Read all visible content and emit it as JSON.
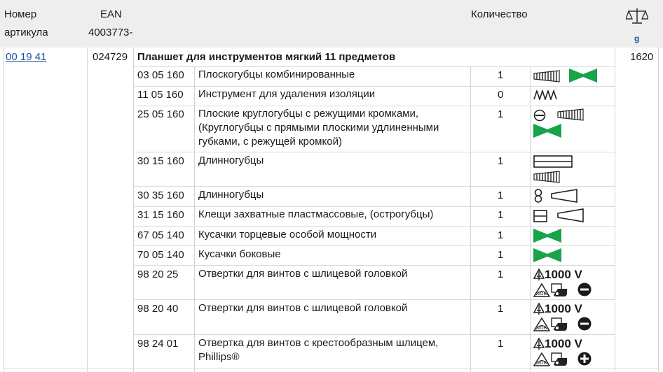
{
  "header": {
    "col_article": "Номер",
    "col_article_2": "артикула",
    "col_ean": "EAN",
    "col_ean_prefix": "4003773-",
    "col_quantity": "Количество",
    "weight_unit": "g",
    "weight_icon": "scale-icon"
  },
  "product": {
    "article": "00 19 41",
    "ean": "024729",
    "title": "Планшет для инструментов мягкий 11 предметов",
    "weight": "1620"
  },
  "items": [
    {
      "code": "03 05 160",
      "desc": "Плоскогубцы комбинированные",
      "qty": "1",
      "icons": [
        "ribbed-grip-icon",
        "cutting-edge-icon"
      ]
    },
    {
      "code": "11 05 160",
      "desc": "Инструмент для удаления изоляции",
      "qty": "0",
      "icons": [
        "zigzag-jaw-icon"
      ]
    },
    {
      "code": "25 05 160",
      "desc": "Плоские круглогубцы с режущими кромками, (Круглогубцы с прямыми плоскими удлиненными губками, с режущей кромкой)",
      "qty": "1",
      "icons": [
        "round-jaw-icon",
        "ribbed-grip-icon",
        "cutting-edge-icon"
      ]
    },
    {
      "code": "30 15 160",
      "desc": "Длинногубцы",
      "qty": "1",
      "icons": [
        "flat-jaw-icon",
        "ribbed-grip-icon"
      ]
    },
    {
      "code": "30 35 160",
      "desc": "Длинногубцы",
      "qty": "1",
      "icons": [
        "figure-eight-icon",
        "tapered-jaw-icon"
      ]
    },
    {
      "code": "31 15 160",
      "desc": "Клещи захватные пластмассовые, (острогубцы)",
      "qty": "1",
      "icons": [
        "square-profile-icon",
        "tapered-jaw-icon"
      ]
    },
    {
      "code": "67 05 140",
      "desc": "Кусачки торцевые особой мощности",
      "qty": "1",
      "icons": [
        "cutting-edge-icon"
      ]
    },
    {
      "code": "70 05 140",
      "desc": "Кусачки боковые",
      "qty": "1",
      "icons": [
        "cutting-edge-icon"
      ]
    },
    {
      "code": "98 20 25",
      "desc": "Отвертки для винтов с шлицевой головкой",
      "qty": "1",
      "icons": [
        "vde-1000v-icon",
        "vde-certified-icon",
        "handle-icon",
        "slotted-icon"
      ]
    },
    {
      "code": "98 20 40",
      "desc": "Отвертки для винтов с шлицевой головкой",
      "qty": "1",
      "icons": [
        "vde-1000v-icon",
        "vde-certified-icon",
        "handle-icon",
        "slotted-icon"
      ]
    },
    {
      "code": "98 24 01",
      "desc": "Отвертка для винтов с крестообразным шлицем, Phillips®",
      "qty": "1",
      "icons": [
        "vde-1000v-icon",
        "vde-certified-icon",
        "handle-icon",
        "phillips-icon"
      ]
    }
  ],
  "labels": {
    "voltage": "1000 V"
  },
  "colors": {
    "header_bg": "#eeeeee",
    "link": "#1a4f9c",
    "green_icon": "#19a34a"
  }
}
